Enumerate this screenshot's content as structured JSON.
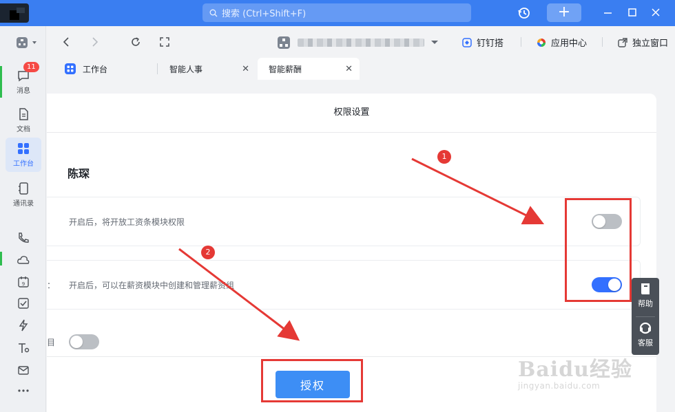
{
  "titlebar": {
    "search_placeholder": "搜索 (Ctrl+Shift+F)",
    "accent": "#3a7ef1"
  },
  "sidebar": {
    "messages_label": "消息",
    "messages_badge": "11",
    "docs_label": "文档",
    "workbench_label": "工作台",
    "contacts_label": "通讯录"
  },
  "navbar": {
    "dingdingda": "钉钉搭",
    "app_center": "应用中心",
    "standalone": "独立窗口"
  },
  "tabs": [
    {
      "label": "工作台"
    },
    {
      "label": "智能人事"
    },
    {
      "label": "智能薪酬"
    }
  ],
  "page": {
    "title": "权限设置",
    "person": "陈琛",
    "row1_desc": "开启后，将开放工资条模块权限",
    "row2_desc": "开启后，可以在薪资模块中创建和管理薪资组",
    "row2_fragment": "：",
    "row3_fragment": "目",
    "authorize": "授权",
    "toggle1_on": false,
    "toggle2_on": true,
    "toggle3_on": false
  },
  "help": {
    "help_label": "帮助",
    "service_label": "客服"
  },
  "annotations": {
    "step1": "1",
    "step2": "2",
    "color": "#e53935"
  },
  "watermark": {
    "main": "Baidu经验",
    "sub": "jingyan.baidu.com"
  }
}
